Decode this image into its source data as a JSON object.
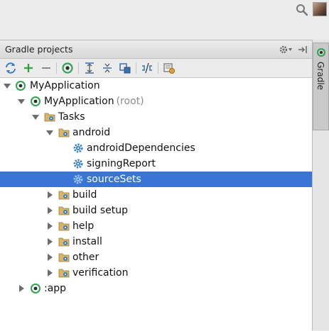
{
  "panel": {
    "title": "Gradle projects",
    "side_tab_label": "Gradle"
  },
  "toolbar": {
    "icons": [
      "refresh-icon",
      "add-icon",
      "remove-icon",
      "gradle-execute-icon",
      "expand-all-icon",
      "collapse-all-icon",
      "link-project-icon",
      "toggle-offline-icon",
      "settings-icon"
    ]
  },
  "tree": {
    "root": {
      "label": "MyApplication"
    },
    "module": {
      "label": "MyApplication",
      "suffix": "(root)"
    },
    "tasks": {
      "label": "Tasks"
    },
    "android": {
      "label": "android"
    },
    "android_tasks": [
      "androidDependencies",
      "signingReport",
      "sourceSets"
    ],
    "task_groups": [
      "build",
      "build setup",
      "help",
      "install",
      "other",
      "verification"
    ],
    "app": {
      "label": ":app"
    }
  },
  "colors": {
    "selection": "#3875d7",
    "gradle_green": "#2ea44f",
    "gear_blue": "#3a7fc3",
    "folder_tan": "#d8b56a"
  }
}
